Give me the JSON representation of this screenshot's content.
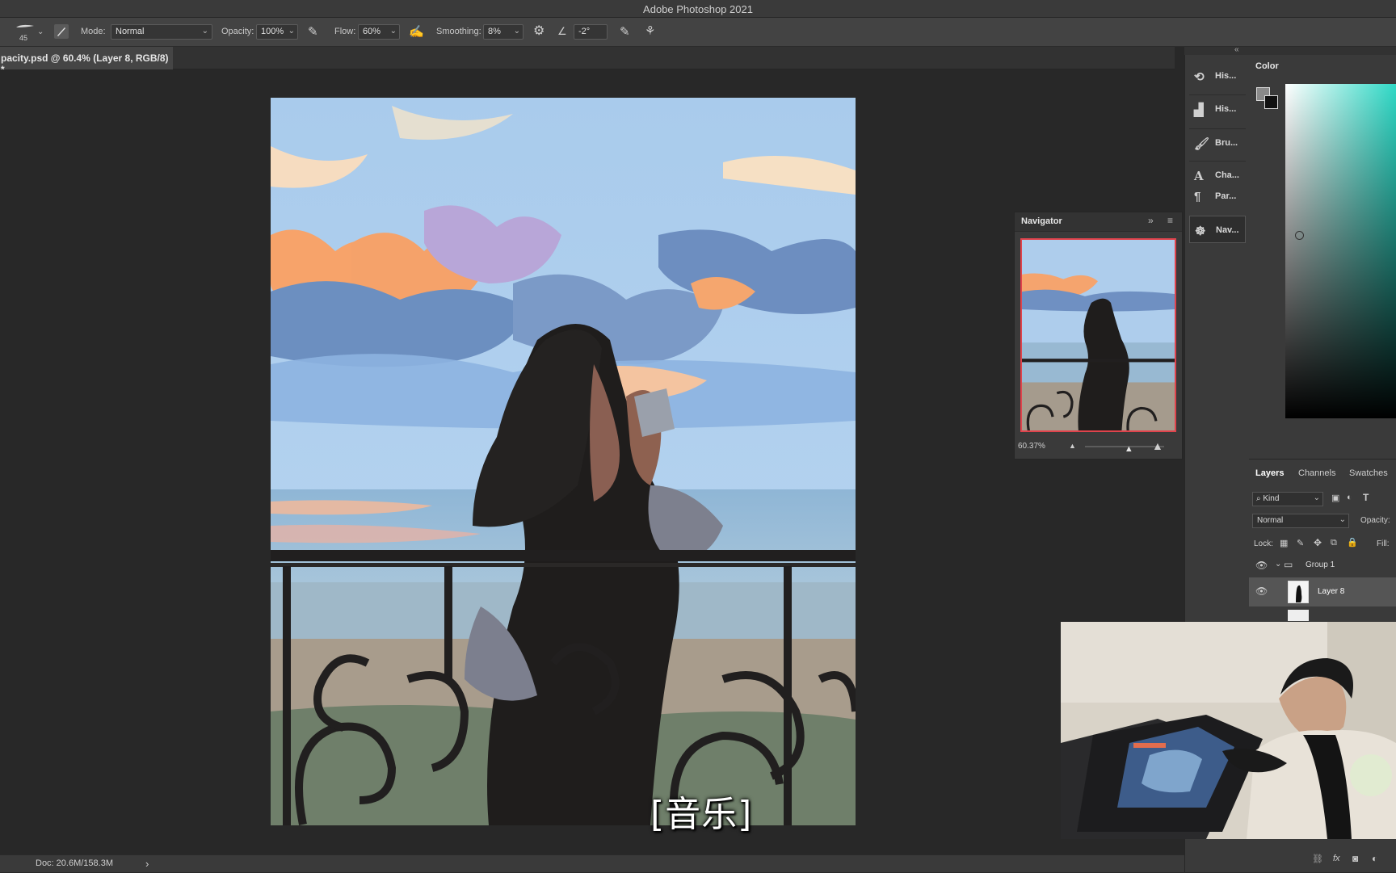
{
  "app": {
    "title": "Adobe Photoshop 2021"
  },
  "options_bar": {
    "brush_size": "45",
    "mode_label": "Mode:",
    "mode_value": "Normal",
    "opacity_label": "Opacity:",
    "opacity_value": "100%",
    "flow_label": "Flow:",
    "flow_value": "60%",
    "smoothing_label": "Smoothing:",
    "smoothing_value": "8%",
    "angle_value": "-2°"
  },
  "document": {
    "tab_title": "pacity.psd @ 60.4% (Layer 8, RGB/8) *",
    "status": "Doc: 20.6M/158.3M",
    "status_arrow": "›"
  },
  "subtitle": "[音乐]",
  "dock": {
    "items": [
      {
        "label": "His...",
        "icon": "history-icon"
      },
      {
        "label": "His...",
        "icon": "histogram-icon"
      },
      {
        "label": "Bru...",
        "icon": "brush-settings-icon"
      },
      {
        "label": "Cha...",
        "icon": "character-icon"
      },
      {
        "label": "Par...",
        "icon": "paragraph-icon"
      },
      {
        "label": "Nav...",
        "icon": "navigator-icon"
      }
    ]
  },
  "color_panel": {
    "tab": "Color"
  },
  "navigator": {
    "title": "Navigator",
    "zoom": "60.37%",
    "zoom_fraction": 0.55
  },
  "layers_panel": {
    "tabs": [
      "Layers",
      "Channels",
      "Swatches"
    ],
    "filter_kind": "Kind",
    "blend_mode": "Normal",
    "opacity_label": "Opacity:",
    "lock_label": "Lock:",
    "fill_label": "Fill:",
    "layers": [
      {
        "name": "Group 1",
        "type": "group"
      },
      {
        "name": "Layer 8",
        "type": "layer",
        "selected": true
      }
    ]
  },
  "colors": {
    "accent": "#4a90d9",
    "panel_bg": "#3a3a3a",
    "canvas_bg": "#282828"
  }
}
